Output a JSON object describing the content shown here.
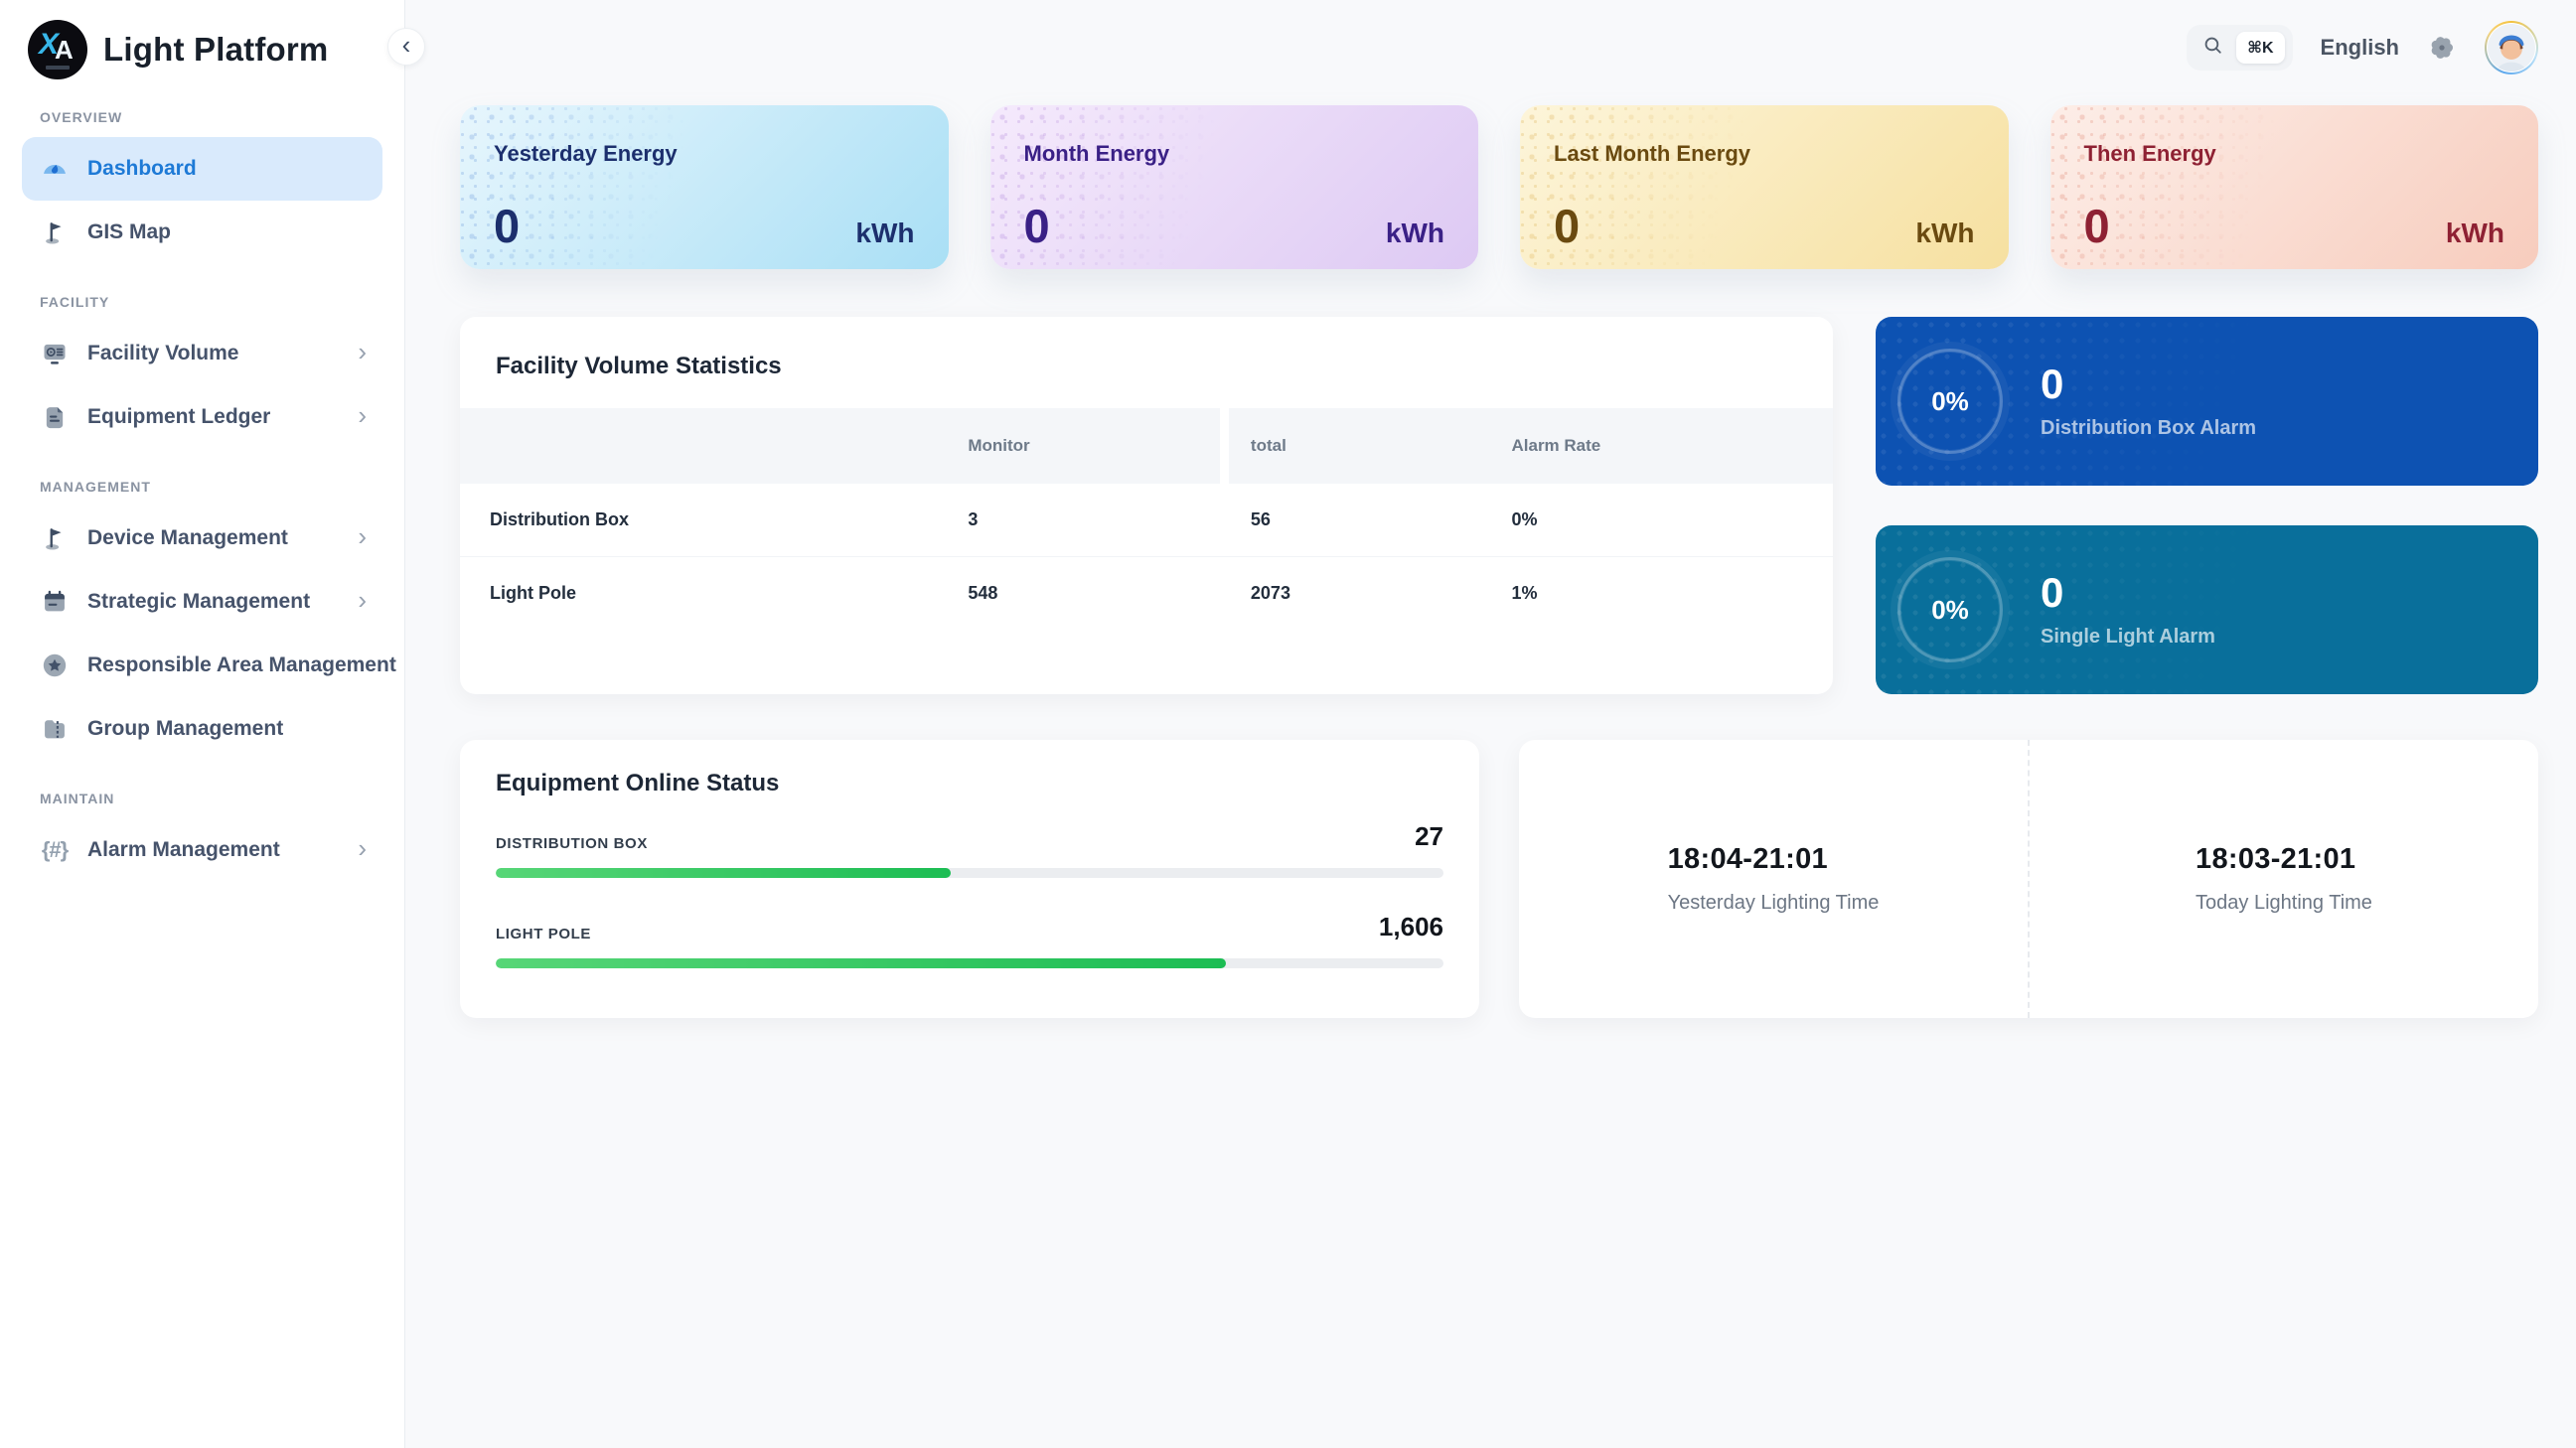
{
  "brand": {
    "name": "Light Platform",
    "logo_letters": [
      "X",
      "A"
    ]
  },
  "topbar": {
    "shortcut": "⌘K",
    "language": "English"
  },
  "icons": {
    "chevron_left": "‹",
    "chevron_right": "›",
    "braces_hash": "{#}"
  },
  "sidebar": {
    "sections": [
      {
        "label": "OVERVIEW",
        "items": [
          {
            "label": "Dashboard",
            "icon": "gauge-icon",
            "active": true
          },
          {
            "label": "GIS Map",
            "icon": "flag-icon"
          }
        ]
      },
      {
        "label": "FACILITY",
        "items": [
          {
            "label": "Facility Volume",
            "icon": "monitor-icon",
            "expandable": true
          },
          {
            "label": "Equipment Ledger",
            "icon": "document-icon",
            "expandable": true
          }
        ]
      },
      {
        "label": "MANAGEMENT",
        "items": [
          {
            "label": "Device Management",
            "icon": "flag-icon",
            "expandable": true
          },
          {
            "label": "Strategic Management",
            "icon": "calendar-icon",
            "expandable": true
          },
          {
            "label": "Responsible Area Management",
            "icon": "star-circle-icon"
          },
          {
            "label": "Group Management",
            "icon": "folder-icon"
          }
        ]
      },
      {
        "label": "MAINTAIN",
        "items": [
          {
            "label": "Alarm Management",
            "icon": "braces-hash-icon",
            "expandable": true
          }
        ]
      }
    ]
  },
  "stats": [
    {
      "title": "Yesterday Energy",
      "value": "0",
      "unit": "kWh",
      "text_color": "#1c2f6d"
    },
    {
      "title": "Month Energy",
      "value": "0",
      "unit": "kWh",
      "text_color": "#3a2086"
    },
    {
      "title": "Last Month Energy",
      "value": "0",
      "unit": "kWh",
      "text_color": "#6a4a10"
    },
    {
      "title": "Then Energy",
      "value": "0",
      "unit": "kWh",
      "text_color": "#8e2133"
    }
  ],
  "facility_stats": {
    "title": "Facility Volume Statistics",
    "columns": [
      "",
      "Monitor",
      "total",
      "Alarm Rate"
    ],
    "rows": [
      [
        "Distribution Box",
        "3",
        "56",
        "0%"
      ],
      [
        "Light Pole",
        "548",
        "2073",
        "1%"
      ]
    ]
  },
  "alarms": [
    {
      "percent": "0%",
      "value": "0",
      "label": "Distribution Box Alarm",
      "color": "#0d52b2"
    },
    {
      "percent": "0%",
      "value": "0",
      "label": "Single Light Alarm",
      "color": "#096f9b"
    }
  ],
  "equipment_status": {
    "title": "Equipment Online Status",
    "items": [
      {
        "label": "DISTRIBUTION BOX",
        "value": "27",
        "width": "48%"
      },
      {
        "label": "LIGHT POLE",
        "value": "1,606",
        "width": "77%"
      }
    ]
  },
  "lighting_times": [
    {
      "time": "18:04-21:01",
      "label": "Yesterday Lighting Time"
    },
    {
      "time": "18:03-21:01",
      "label": "Today Lighting Time"
    }
  ],
  "colors": {
    "accent": "#1e7ad6",
    "progress_green": "#1cbd53",
    "page_bg": "#f8f9fb"
  }
}
